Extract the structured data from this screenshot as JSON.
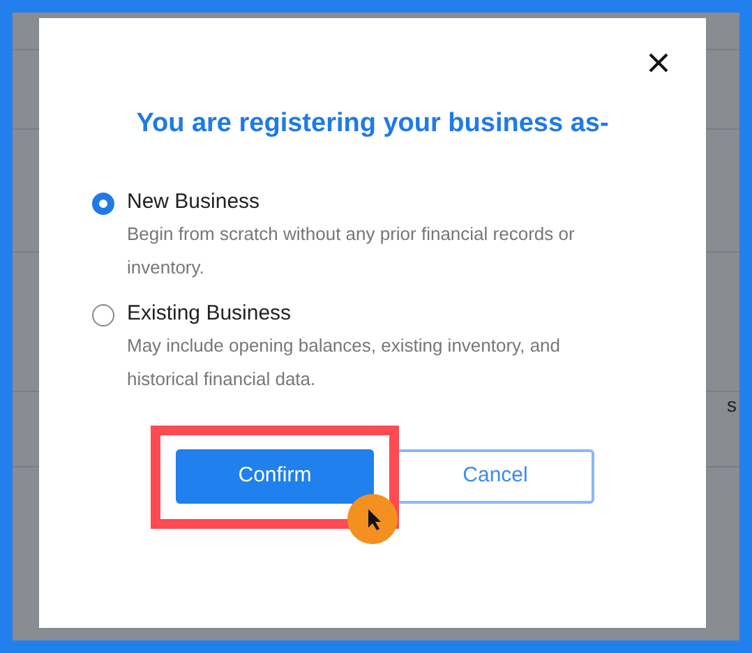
{
  "background": {
    "cut_text": "s"
  },
  "dialog": {
    "title": "You are registering your business as-",
    "options": [
      {
        "label": "New Business",
        "description": "Begin from scratch without any prior financial records or inventory.",
        "selected": true
      },
      {
        "label": "Existing Business",
        "description": "May include opening balances, existing inventory, and historical financial data.",
        "selected": false
      }
    ],
    "buttons": [
      {
        "label": "Confirm",
        "kind": "primary",
        "highlighted": true
      },
      {
        "label": "Cancel",
        "kind": "secondary",
        "highlighted": false
      }
    ]
  }
}
